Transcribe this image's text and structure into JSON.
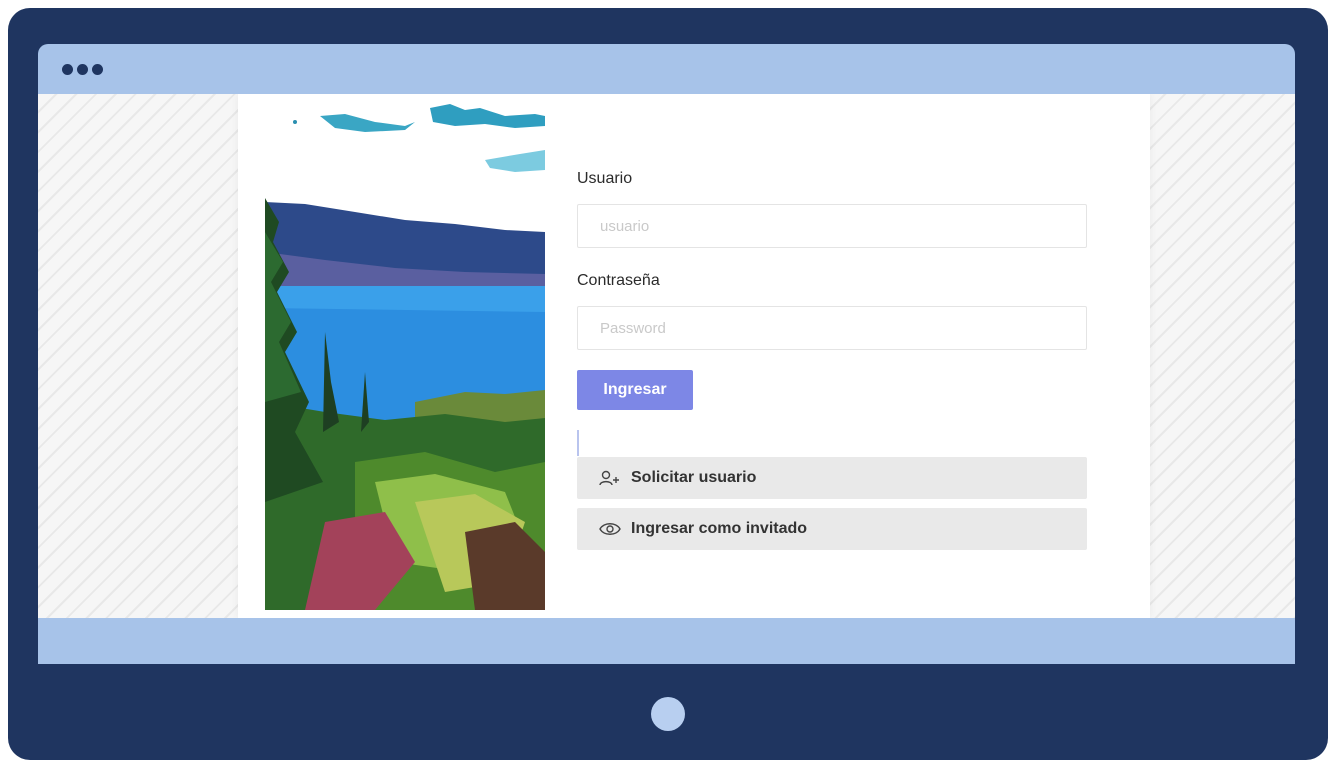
{
  "login": {
    "user_label": "Usuario",
    "user_placeholder": "usuario",
    "password_label": "Contraseña",
    "password_placeholder": "Password",
    "submit_label": "Ingresar",
    "request_user_label": "Solicitar usuario",
    "guest_label": "Ingresar como invitado"
  },
  "icons": {
    "window_dots": "window-dots-icon",
    "request_user": "user-plus-icon",
    "guest": "eye-icon"
  },
  "colors": {
    "frame": "#1f3560",
    "accent": "#7d87e6",
    "screen_bar": "#a7c3e9"
  }
}
